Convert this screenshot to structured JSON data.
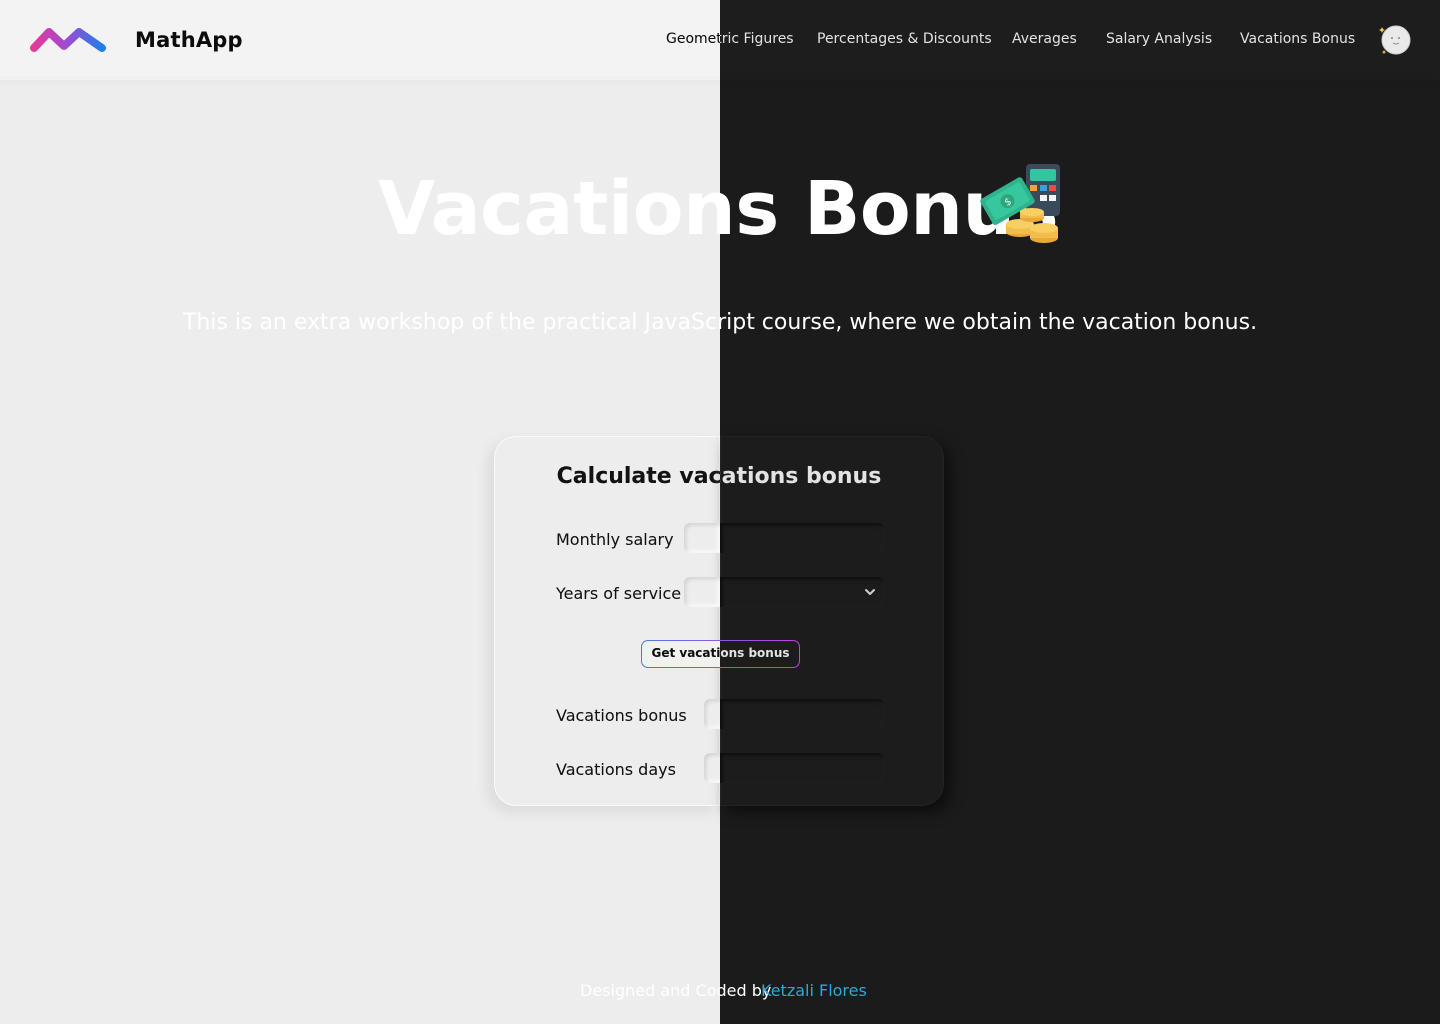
{
  "app": {
    "brand": "MathApp"
  },
  "nav": {
    "items": [
      {
        "label": "Geometric Figures"
      },
      {
        "label": "Percentages & Discounts"
      },
      {
        "label": "Averages"
      },
      {
        "label": "Salary Analysis"
      },
      {
        "label": "Vacations Bonus"
      }
    ]
  },
  "hero": {
    "title": "Vacations Bonus",
    "subtitle": "This is an extra workshop of the practical JavaScript course, where we obtain the vacation bonus."
  },
  "card": {
    "title": "Calculate vacations bonus",
    "monthly_salary_label": "Monthly salary",
    "monthly_salary_value": "",
    "years_label": "Years of service",
    "years_value": "",
    "button_label": "Get vacations bonus",
    "bonus_label": "Vacations bonus",
    "bonus_value": "",
    "days_label": "Vacations days",
    "days_value": ""
  },
  "footer": {
    "text": "Designed and Coded by",
    "author": "Ketzali Flores"
  },
  "colors": {
    "light_bg": "#ededed",
    "dark_bg": "#1b1b1b",
    "link": "#2fa7d8",
    "button_gradient_start": "#4c7bd9",
    "button_gradient_end": "#c63fe0"
  },
  "icons": {
    "logo": "mathapp-logo-icon",
    "theme_toggle": "moon-icon",
    "title_art": "money-calculator-icon",
    "select_arrow": "chevron-down-icon"
  }
}
